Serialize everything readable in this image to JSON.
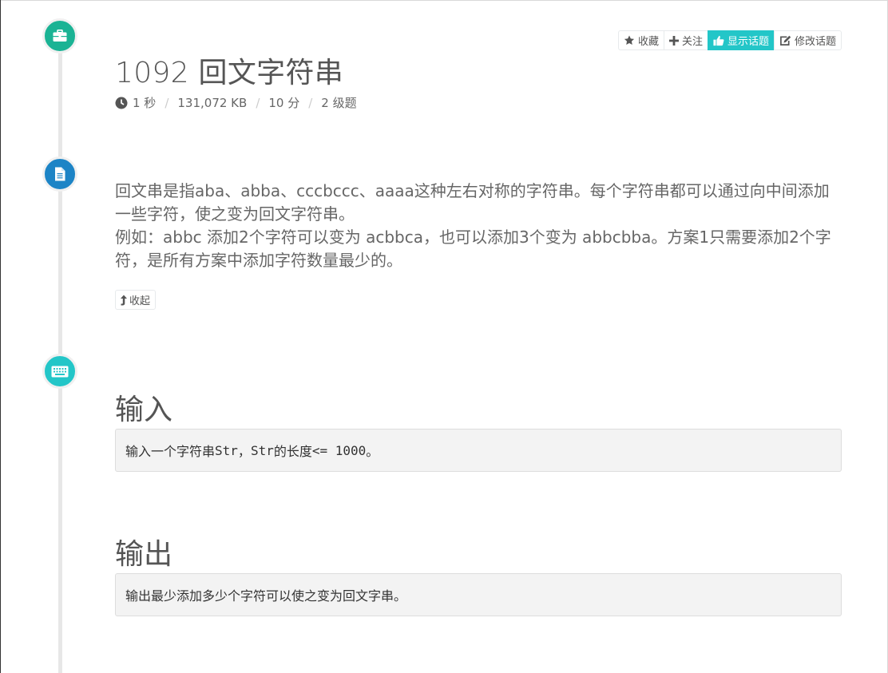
{
  "toolbar": {
    "favorite_label": "收藏",
    "follow_label": "关注",
    "show_topic_label": "显示话题",
    "edit_topic_label": "修改话题",
    "accent": "#23c6c8"
  },
  "problem": {
    "title": "1092 回文字符串",
    "time_limit": "1 秒",
    "memory_limit": "131,072 KB",
    "score": "10 分",
    "level": "2 级题"
  },
  "description": {
    "paragraph1": "回文串是指aba、abba、cccbccc、aaaa这种左右对称的字符串。每个字符串都可以通过向中间添加一些字符，使之变为回文字符串。",
    "paragraph2": "例如：abbc 添加2个字符可以变为 acbbca，也可以添加3个变为 abbcbba。方案1只需要添加2个字符，是所有方案中添加字符数量最少的。",
    "collapse_label": "收起"
  },
  "input": {
    "heading": "输入",
    "text_prefix": "输入一个字符串",
    "code1": "Str",
    "comma": "，",
    "code2": "Str",
    "text_mid": "的长度 ",
    "code3": "<= 1000",
    "text_end": "。"
  },
  "output": {
    "heading": "输出",
    "text": "输出最少添加多少个字符可以使之变为回文字串。"
  },
  "icons": {
    "section1": "briefcase-icon",
    "section2": "file-text-icon",
    "section3": "keyboard-icon"
  }
}
